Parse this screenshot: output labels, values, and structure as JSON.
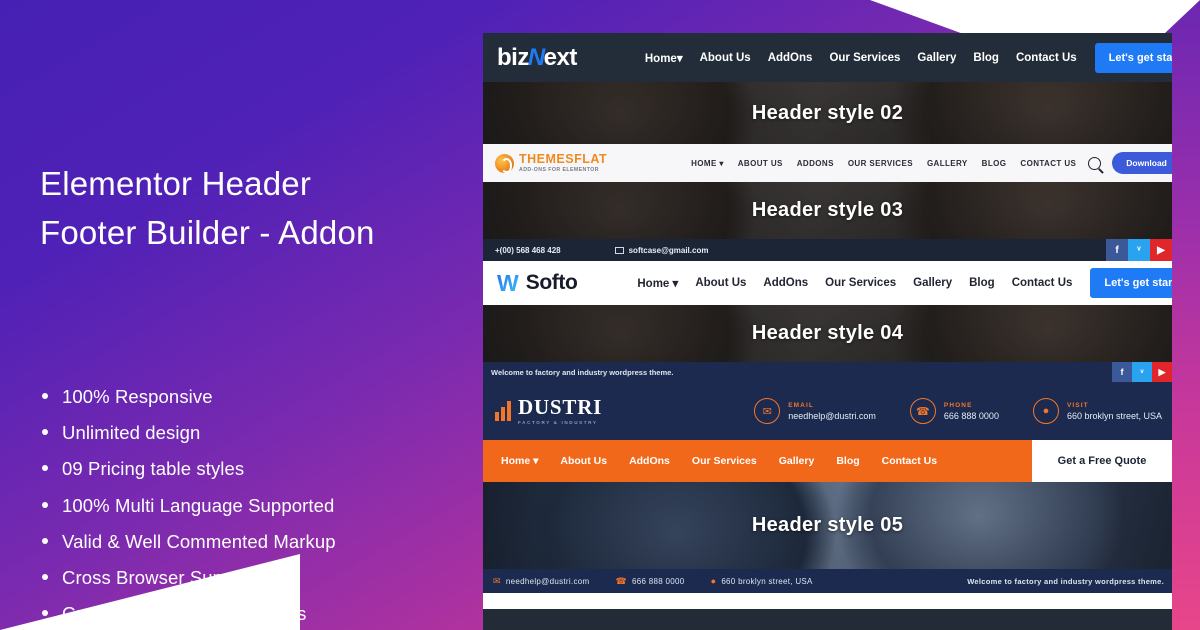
{
  "promo": {
    "headline_line1": "Elementor Header",
    "headline_line2": "Footer Builder - Addon",
    "features": [
      "100% Responsive",
      "Unlimited design",
      "09 Pricing table styles",
      "100% Multi Language Supported",
      "Valid & Well Commented Markup",
      "Cross Browser Supported",
      "Guarantee of regular updates"
    ],
    "colors": {
      "bg_start": "#4620b4",
      "bg_end": "#ef4b87"
    }
  },
  "preview": {
    "header_01": {
      "logo_text_a": "biz",
      "logo_mark": "N",
      "logo_text_b": "ext",
      "nav": [
        "Home",
        "About Us",
        "AddOns",
        "Our Services",
        "Gallery",
        "Blog",
        "Contact Us"
      ],
      "home_caret": "▾",
      "cta": "Let's get started",
      "cta_color": "#1f7bf5"
    },
    "band_02": {
      "label": "Header style 02"
    },
    "header_02": {
      "logo_name": "THEMESFLAT",
      "logo_tagline": "ADD-ONS FOR ELEMENTOR",
      "nav": [
        "HOME",
        "ABOUT US",
        "ADDONS",
        "OUR SERVICES",
        "GALLERY",
        "BLOG",
        "CONTACT US"
      ],
      "home_caret": "▾",
      "search_icon": "search-icon",
      "cta": "Download",
      "cta_color": "#3b5bdb"
    },
    "band_03": {
      "label": "Header style 03"
    },
    "header_03": {
      "topbar": {
        "phone": "+(00) 568 468 428",
        "email": "softcase@gmail.com",
        "socials": [
          "f",
          "ᵛ",
          "▶"
        ]
      },
      "logo_mark": "W",
      "logo_name": "Softo",
      "nav": [
        "Home",
        "About Us",
        "AddOns",
        "Our Services",
        "Gallery",
        "Blog",
        "Contact Us"
      ],
      "home_caret": "▾",
      "cta": "Let's get started",
      "cta_color": "#1f7bf5"
    },
    "band_04": {
      "label": "Header style 04"
    },
    "header_04": {
      "topbar_text": "Welcome to factory and industry wordpress theme.",
      "socials": [
        "f",
        "ᵛ",
        "▶"
      ],
      "logo_name": "DUSTRI",
      "logo_tagline": "FACTORY & INDUSTRY",
      "contacts": [
        {
          "icon": "✉",
          "title": "EMAIL",
          "value": "needhelp@dustri.com"
        },
        {
          "icon": "☎",
          "title": "PHONE",
          "value": "666 888 0000"
        },
        {
          "icon": "●",
          "title": "VISIT",
          "value": "660 broklyn street, USA"
        }
      ],
      "nav": [
        "Home",
        "About Us",
        "AddOns",
        "Our Services",
        "Gallery",
        "Blog",
        "Contact Us"
      ],
      "home_caret": "▾",
      "cta": "Get a Free Quote",
      "nav_color": "#f2681a"
    },
    "band_05": {
      "label": "Header style 05"
    },
    "footer_bar": {
      "email": "needhelp@dustri.com",
      "phone": "666 888 0000",
      "address": "660 broklyn street, USA",
      "welcome": "Welcome to factory and industry wordpress theme."
    }
  }
}
